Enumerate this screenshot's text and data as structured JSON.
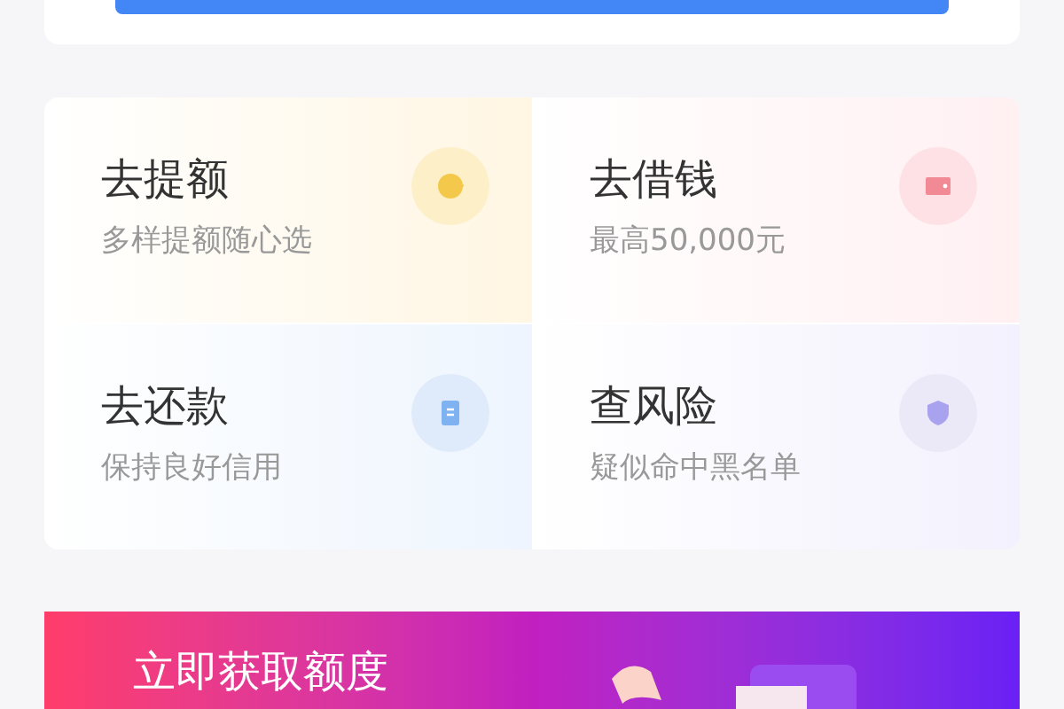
{
  "tiles": [
    {
      "kind": "coin",
      "title": "去提额",
      "subtitle": "多样提额随心选"
    },
    {
      "kind": "wallet",
      "title": "去借钱",
      "subtitle": "最高50,000元"
    },
    {
      "kind": "bill",
      "title": "去还款",
      "subtitle": "保持良好信用"
    },
    {
      "kind": "shield",
      "title": "查风险",
      "subtitle": "疑似命中黑名单"
    }
  ],
  "banner": {
    "title": "立即获取额度"
  }
}
